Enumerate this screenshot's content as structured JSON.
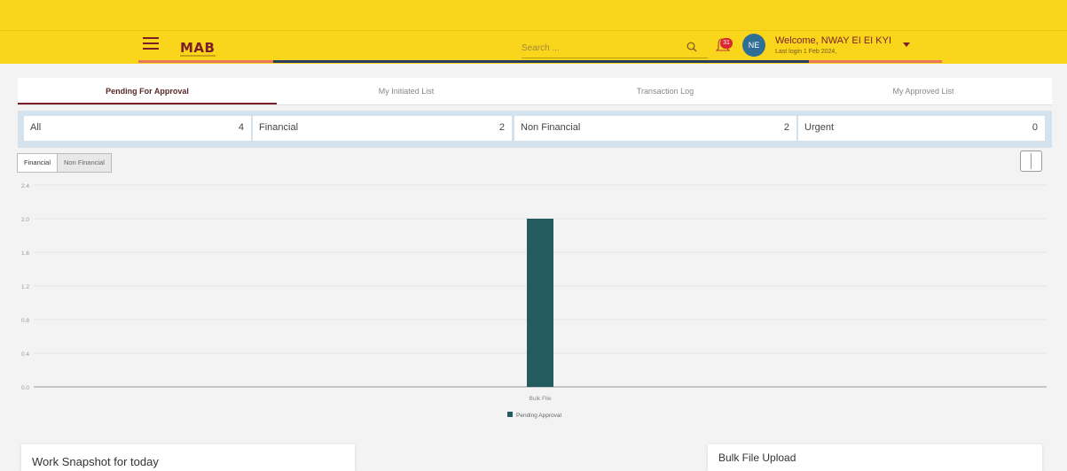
{
  "header": {
    "logo_text": "MAB",
    "search_placeholder": "Search ...",
    "notification_count": "31",
    "avatar_initials": "NE",
    "welcome_text": "Welcome, NWAY EI EI KYI",
    "last_login": "Last login 1 Feb 2024,"
  },
  "tabs": [
    {
      "label": "Pending For Approval",
      "active": true
    },
    {
      "label": "My Initiated List",
      "active": false
    },
    {
      "label": "Transaction Log",
      "active": false
    },
    {
      "label": "My Approved List",
      "active": false
    }
  ],
  "counts": [
    {
      "label": "All",
      "value": "4"
    },
    {
      "label": "Financial",
      "value": "2"
    },
    {
      "label": "Non Financial",
      "value": "2"
    },
    {
      "label": "Urgent",
      "value": "0"
    }
  ],
  "chart_toggle": {
    "active": "Financial",
    "inactive": "Non Financial"
  },
  "chart_data": {
    "type": "bar",
    "categories": [
      "Bulk File"
    ],
    "series": [
      {
        "name": "Pending Approval",
        "values": [
          2
        ]
      }
    ],
    "yticks": [
      "2.4",
      "2.0",
      "1.6",
      "1.2",
      "0.8",
      "0.4",
      "0.0"
    ],
    "ylim": [
      0,
      2.4
    ],
    "grid": true,
    "legend_position": "bottom",
    "bar_color": "#235b5e"
  },
  "cards": {
    "left_title": "Work Snapshot for today",
    "right_title": "Bulk File Upload"
  },
  "colors": {
    "header_bg": "#f9d51b",
    "brand": "#7a1f2b",
    "strip_bg": "#d4e2ee"
  }
}
